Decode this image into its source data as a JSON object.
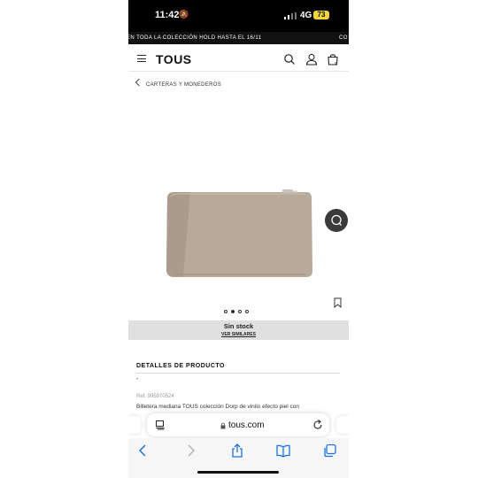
{
  "status": {
    "time": "11:42",
    "network": "4G",
    "battery": "73"
  },
  "promo": {
    "text_left": "EN TODA LA COLECCIÓN HOLD HASTA EL 16/11",
    "text_right": "CO"
  },
  "header": {
    "logo": "TOUS"
  },
  "breadcrumb": {
    "label": "CARTERAS Y MONEDEROS"
  },
  "product": {
    "image_color": "#b7aa9b",
    "carousel": {
      "count": 4,
      "active": 2
    },
    "stock_label": "Sin stock",
    "similar_label": "VER SIMILARES"
  },
  "details": {
    "heading": "DETALLES DE PRODUCTO",
    "dash": "-",
    "ref": "Ref. 995970524",
    "description": "Billetera mediana TOUS colección Dorp de vinilo efecto piel con"
  },
  "browser": {
    "domain": "tous.com",
    "accent": "#1a73e8"
  },
  "icons": {
    "header": [
      "menu-icon",
      "search-icon",
      "user-icon",
      "bag-icon"
    ],
    "browser": [
      "reader-icon",
      "lock-icon",
      "reload-icon"
    ],
    "bottom": [
      "back-icon",
      "forward-icon",
      "share-icon",
      "bookmarks-icon",
      "tabs-icon"
    ]
  }
}
